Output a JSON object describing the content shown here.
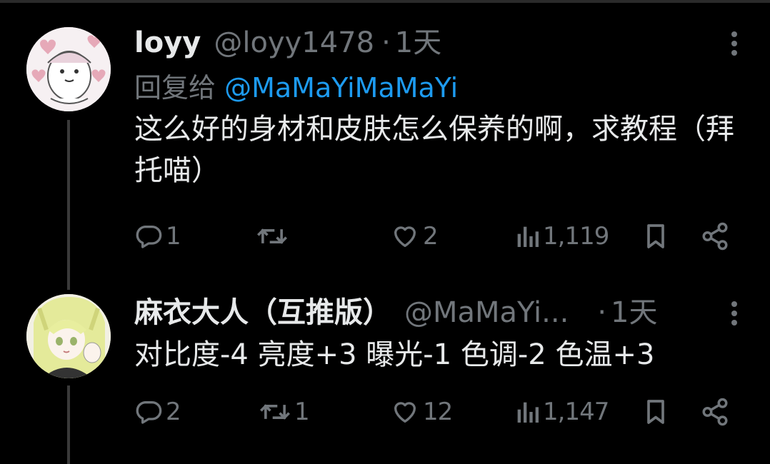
{
  "tweets": [
    {
      "name": "loyy",
      "handle": "@loyy1478",
      "separator": "·",
      "time": "1天",
      "reply_label": "回复给 ",
      "reply_mention": "@MaMaYiMaMaYi",
      "text": "这么好的身材和皮肤怎么保养的啊，求教程（拜托喵）",
      "actions": {
        "replies": "1",
        "retweets": "",
        "likes": "2",
        "views": "1,119"
      }
    },
    {
      "name": "麻衣大人（互推版）",
      "handle": "@MaMaYi...",
      "separator": "·",
      "time": "1天",
      "text": "对比度-4 亮度+3 曝光-1 色调-2 色温+3",
      "actions": {
        "replies": "2",
        "retweets": "1",
        "likes": "12",
        "views": "1,147"
      }
    }
  ],
  "icons": {
    "reply": "reply-icon",
    "retweet": "retweet-icon",
    "like": "heart-icon",
    "views": "views-icon",
    "bookmark": "bookmark-icon",
    "share": "share-icon",
    "more": "more-icon"
  },
  "colors": {
    "background": "#000000",
    "primary_text": "#e7e9ea",
    "secondary_text": "#71767b",
    "mention": "#1d9bf0"
  }
}
